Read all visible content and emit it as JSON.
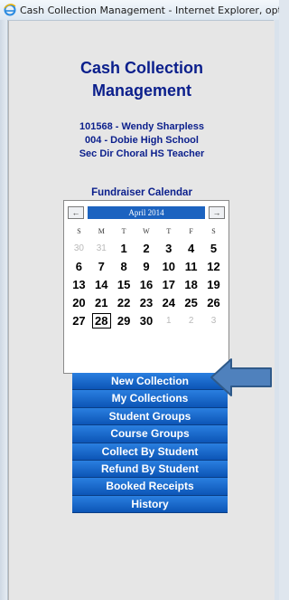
{
  "window": {
    "title": "Cash Collection Management - Internet Explorer, optim"
  },
  "app": {
    "title_line1": "Cash Collection",
    "title_line2": "Management"
  },
  "user": {
    "line1": "101568 - Wendy Sharpless",
    "line2": "004 - Dobie High School",
    "line3": "Sec Dir Choral HS Teacher"
  },
  "calendar": {
    "heading": "Fundraiser Calendar",
    "month_label": "April 2014",
    "prev_label": "←",
    "next_label": "→",
    "weekdays": [
      "S",
      "M",
      "T",
      "W",
      "T",
      "F",
      "S"
    ],
    "weeks": [
      [
        "30",
        "31",
        "1",
        "2",
        "3",
        "4",
        "5"
      ],
      [
        "6",
        "7",
        "8",
        "9",
        "10",
        "11",
        "12"
      ],
      [
        "13",
        "14",
        "15",
        "16",
        "17",
        "18",
        "19"
      ],
      [
        "20",
        "21",
        "22",
        "23",
        "24",
        "25",
        "26"
      ],
      [
        "27",
        "28",
        "29",
        "30",
        "1",
        "2",
        "3"
      ]
    ],
    "selected_day": "28"
  },
  "menu": {
    "items": [
      "New Collection",
      "My Collections",
      "Student Groups",
      "Course Groups",
      "Collect By Student",
      "Refund By Student",
      "Booked Receipts",
      "History"
    ]
  },
  "colors": {
    "accent": "#0b1f8c",
    "button": "#1c63c0",
    "arrow": "#4f81bd"
  },
  "icons": {
    "browser": "internet-explorer-icon",
    "pointer": "callout-arrow-icon"
  }
}
